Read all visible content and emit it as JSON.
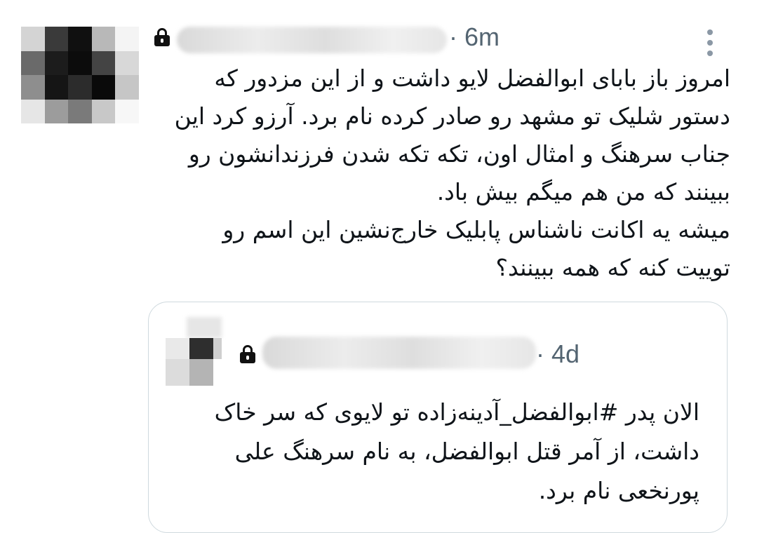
{
  "tweet": {
    "time": "6m",
    "text_lines": [
      "امروز باز بابای ابوالفضل لایو داشت و از این مزدور که",
      "دستور شلیک تو مشهد رو صادر کرده نام برد. آرزو کرد این",
      "جناب سرهنگ و امثال اون، تکه تکه شدن فرزندانشون رو",
      "ببینند که من هم میگم بیش باد.",
      "میشه یه اکانت ناشناس پابلیک خارج‌نشین این اسم رو",
      "توییت کنه که همه ببینند؟"
    ]
  },
  "quoted_tweet": {
    "time": "4d",
    "text_lines": [
      "الان پدر #ابوالفضل_آدینه‌زاده تو لایوی که سر خاک",
      "داشت، از آمر قتل ابوالفضل، به نام سرهنگ علی",
      "پورنخعی نام برد."
    ]
  },
  "icons": {
    "lock": "lock-icon",
    "more": "more-options-icon"
  },
  "colors": {
    "text": "#0f1419",
    "secondary": "#536471",
    "border": "#cfd9de"
  }
}
